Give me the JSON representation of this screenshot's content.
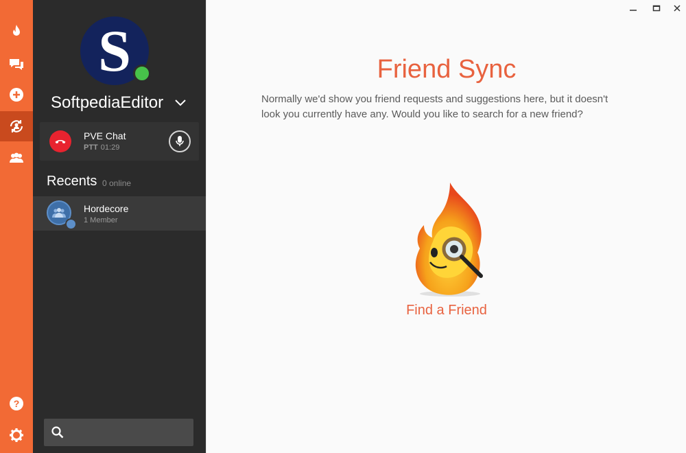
{
  "window": {
    "minimize_glyph": "–",
    "maximize_glyph": "□",
    "close_glyph": "✕"
  },
  "rail": {
    "items": [
      {
        "icon": "flame-icon"
      },
      {
        "icon": "chat-bubbles-icon"
      },
      {
        "icon": "add-icon"
      },
      {
        "icon": "friend-sync-icon",
        "active": true
      },
      {
        "icon": "group-icon"
      }
    ],
    "bottom": [
      {
        "icon": "help-icon"
      },
      {
        "icon": "gear-icon"
      }
    ]
  },
  "profile": {
    "avatar_letter": "S",
    "username": "SoftpediaEditor",
    "status": "online"
  },
  "call": {
    "name": "PVE Chat",
    "mode": "PTT",
    "duration": "01:29"
  },
  "recents": {
    "title": "Recents",
    "online_count": "0 online",
    "items": [
      {
        "name": "Hordecore",
        "sub": "1 Member"
      }
    ]
  },
  "search": {
    "placeholder": ""
  },
  "main": {
    "title": "Friend Sync",
    "description": "Normally we'd show you friend requests and suggestions here, but it doesn't look you currently have any. Would you like to search for a new friend?",
    "action_label": "Find a Friend"
  },
  "colors": {
    "accent": "#f26a35",
    "title": "#e8623f",
    "sidebar": "#2b2b2b",
    "online": "#47c24a",
    "hangup": "#e8232f"
  }
}
